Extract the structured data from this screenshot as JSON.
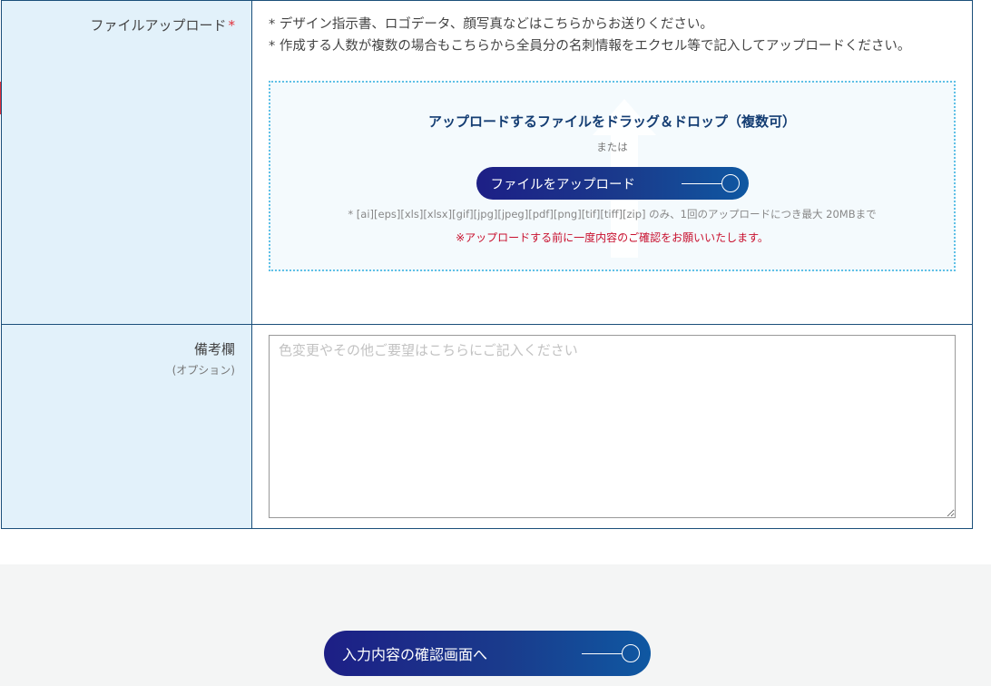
{
  "upload": {
    "label": "ファイルアップロード",
    "required_mark": "*",
    "note_1": "* デザイン指示書、ロゴデータ、顔写真などはこちらからお送りください。",
    "note_2": "* 作成する人数が複数の場合もこちらから全員分の名刺情報をエクセル等で記入してアップロードください。",
    "dropzone": {
      "title": "アップロードするファイルをドラッグ＆ドロップ（複数可）",
      "or_text": "または",
      "button_label": "ファイルをアップロード",
      "formats": "* [ai][eps][xls][xlsx][gif][jpg][jpeg][pdf][png][tif][tiff][zip] のみ、1回のアップロードにつき最大 20MBまで",
      "warning": "※アップロードする前に一度内容のご確認をお願いいたします。"
    }
  },
  "remarks": {
    "label": "備考欄",
    "sub_label": "(オプション)",
    "value": "",
    "placeholder": "色変更やその他ご要望はこちらにご記入ください"
  },
  "submit": {
    "label": "入力内容の確認画面へ"
  },
  "colors": {
    "label_bg": "#e2f1fa",
    "border": "#1b4f7a",
    "button_gradient_start": "#1d1f86",
    "button_gradient_end": "#0f58a2",
    "warning": "#c8102e",
    "required": "#e0303a"
  }
}
